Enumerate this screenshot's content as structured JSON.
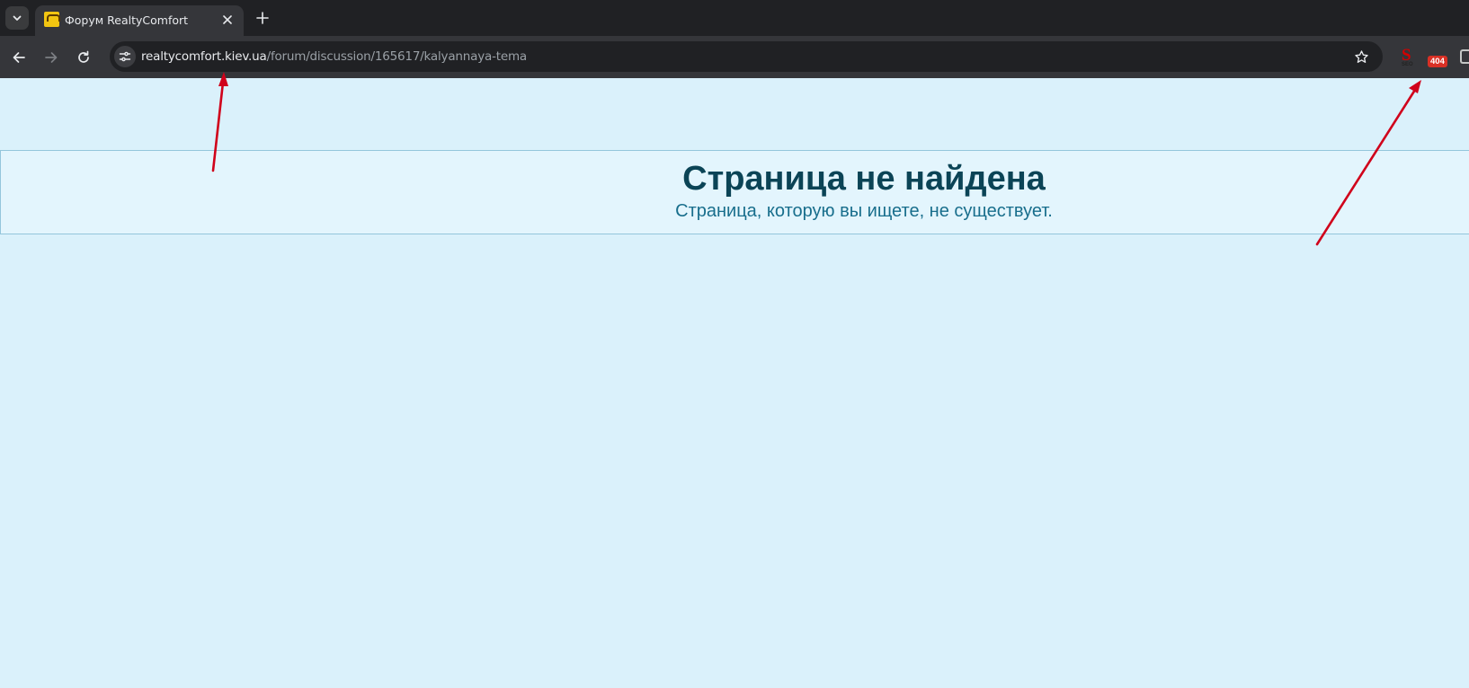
{
  "browser": {
    "tab": {
      "title": "Форум RealtyComfort"
    },
    "address_bar": {
      "host": "realtycomfort.kiev.ua",
      "path": "/forum/discussion/165617/kalyannaya-tema"
    },
    "extensions": {
      "seo_label": "S",
      "seo_sub": "SEO",
      "badge_404": "404"
    }
  },
  "page": {
    "title": "Страница не найдена",
    "subtitle": "Страница, которую вы ищете, не существует."
  },
  "colors": {
    "page_background": "#daf1fb",
    "banner_background": "#e3f5fd",
    "title_color": "#0b4456",
    "subtitle_color": "#186e8c",
    "annotation_arrow": "#d0021b"
  }
}
